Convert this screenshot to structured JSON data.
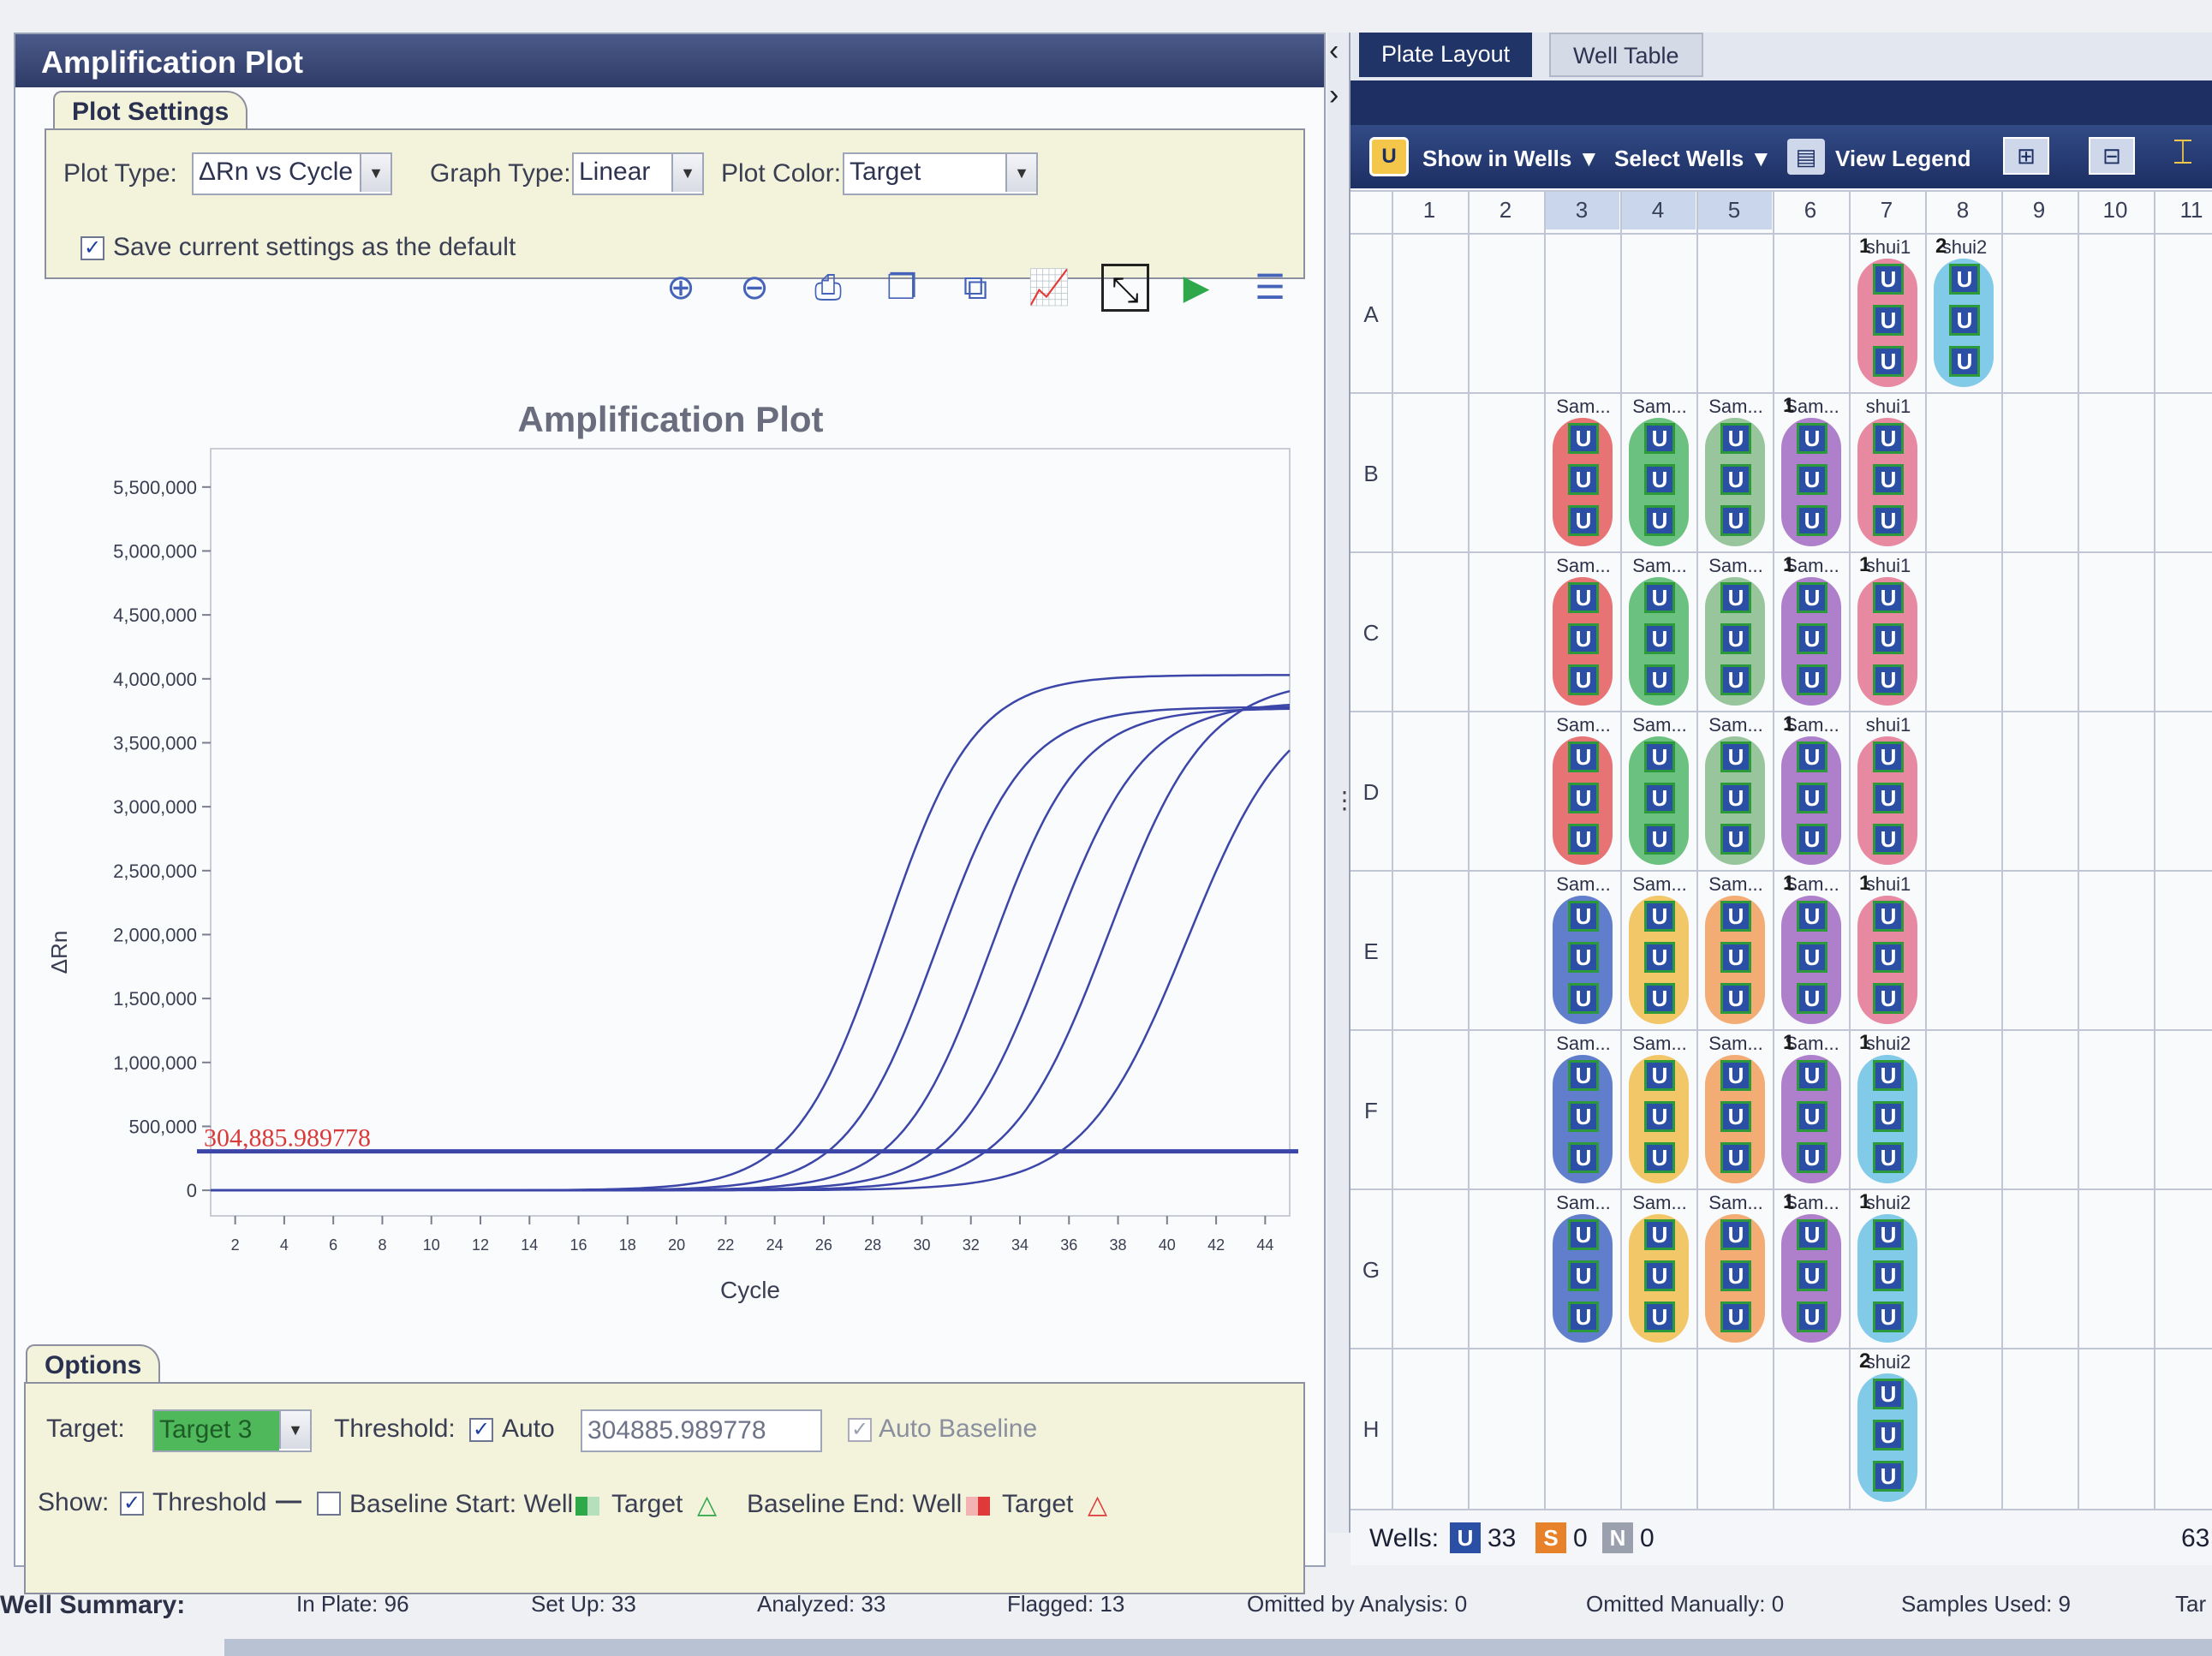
{
  "left_panel": {
    "title": "Amplification Plot",
    "plot_settings": {
      "group_label": "Plot Settings",
      "plot_type_label": "Plot Type:",
      "plot_type_value": "ΔRn vs Cycle",
      "graph_type_label": "Graph Type:",
      "graph_type_value": "Linear",
      "plot_color_label": "Plot Color:",
      "plot_color_value": "Target",
      "save_default_label": "Save current settings as the default",
      "save_default_checked": true
    },
    "toolbar_icons": [
      "zoom-in-icon",
      "zoom-out-icon",
      "print-icon",
      "copy-icon",
      "export-icon",
      "line-chart-icon",
      "expand-icon",
      "play-icon",
      "list-icon"
    ],
    "options": {
      "group_label": "Options",
      "target_label": "Target:",
      "target_value": "Target 3",
      "threshold_label": "Threshold:",
      "auto_label": "Auto",
      "threshold_value": "304885.989778",
      "auto_baseline_label": "Auto Baseline",
      "show_label": "Show:",
      "show_threshold_label": "Threshold",
      "baseline_start_label": "Baseline Start: Well",
      "baseline_start_target": "Target",
      "baseline_end_label": "Baseline End: Well",
      "baseline_end_target": "Target",
      "line_symbol": "—",
      "target_symbol": "△"
    }
  },
  "chart_data": {
    "type": "line",
    "title": "Amplification Plot",
    "xlabel": "Cycle",
    "ylabel": "ΔRn",
    "xlim": [
      1,
      45
    ],
    "ylim": [
      -200000,
      5800000
    ],
    "xticks": [
      "2",
      "4",
      "6",
      "8",
      "10",
      "12",
      "14",
      "16",
      "18",
      "20",
      "22",
      "24",
      "26",
      "28",
      "30",
      "32",
      "34",
      "36",
      "38",
      "40",
      "42",
      "44"
    ],
    "yticks": [
      "5,500,000",
      "5,000,000",
      "4,500,000",
      "4,000,000",
      "3,500,000",
      "3,000,000",
      "2,500,000",
      "2,000,000",
      "1,500,000",
      "1,000,000",
      "500,000",
      "0"
    ],
    "ytick_values": [
      5500000,
      5000000,
      4500000,
      4000000,
      3500000,
      3000000,
      2500000,
      2000000,
      1500000,
      1000000,
      500000,
      0
    ],
    "threshold": 304885.989778,
    "threshold_label": "304,885.989778",
    "series_color": "#3b46a8",
    "threshold_color": "#3b46a8",
    "threshold_label_color": "#d93a3a",
    "curves": [
      {
        "plateau": 4030000,
        "midpoint": 28.5,
        "slope": 0.55
      },
      {
        "plateau": 3780000,
        "midpoint": 30.6,
        "slope": 0.55
      },
      {
        "plateau": 3770000,
        "midpoint": 32.8,
        "slope": 0.55
      },
      {
        "plateau": 3820000,
        "midpoint": 35.2,
        "slope": 0.52
      },
      {
        "plateau": 4000000,
        "midpoint": 37.6,
        "slope": 0.5
      },
      {
        "plateau": 3900000,
        "midpoint": 40.8,
        "slope": 0.48
      }
    ]
  },
  "right_panel": {
    "tabs": [
      {
        "label": "Plate Layout",
        "active": true
      },
      {
        "label": "Well Table",
        "active": false
      }
    ],
    "toolbar": {
      "show_in_wells": "Show in Wells ▼",
      "select_wells": "Select Wells ▼",
      "view_legend": "View Legend"
    },
    "columns": [
      "1",
      "2",
      "3",
      "4",
      "5",
      "6",
      "7",
      "8",
      "9",
      "10",
      "11"
    ],
    "rows": [
      "A",
      "B",
      "C",
      "D",
      "E",
      "F",
      "G",
      "H"
    ],
    "wells_footer": {
      "label": "Wells:",
      "u_icon": "U",
      "u_count": "33",
      "s_icon": "S",
      "s_count": "0",
      "n_icon": "N",
      "n_count": "0",
      "right_count": "63"
    },
    "wells": [
      {
        "row": 0,
        "col": 6,
        "name": "shui1",
        "flag": "1",
        "color": "#e05a7a"
      },
      {
        "row": 0,
        "col": 7,
        "name": "shui2",
        "flag": "2",
        "color": "#4fb5e0"
      },
      {
        "row": 1,
        "col": 2,
        "name": "Sam...",
        "color": "#e0393a"
      },
      {
        "row": 1,
        "col": 3,
        "name": "Sam...",
        "color": "#2fa84a"
      },
      {
        "row": 1,
        "col": 4,
        "name": "Sam...",
        "color": "#6fae72"
      },
      {
        "row": 1,
        "col": 5,
        "name": "Sam...",
        "flag": "1",
        "color": "#8f4bb8"
      },
      {
        "row": 1,
        "col": 6,
        "name": "shui1",
        "color": "#e05a7a"
      },
      {
        "row": 2,
        "col": 2,
        "name": "Sam...",
        "color": "#e0393a"
      },
      {
        "row": 2,
        "col": 3,
        "name": "Sam...",
        "color": "#2fa84a"
      },
      {
        "row": 2,
        "col": 4,
        "name": "Sam...",
        "color": "#6fae72"
      },
      {
        "row": 2,
        "col": 5,
        "name": "Sam...",
        "flag": "1",
        "color": "#8f4bb8"
      },
      {
        "row": 2,
        "col": 6,
        "name": "shui1",
        "flag": "1",
        "color": "#e05a7a"
      },
      {
        "row": 3,
        "col": 2,
        "name": "Sam...",
        "color": "#e0393a"
      },
      {
        "row": 3,
        "col": 3,
        "name": "Sam...",
        "color": "#2fa84a"
      },
      {
        "row": 3,
        "col": 4,
        "name": "Sam...",
        "color": "#6fae72"
      },
      {
        "row": 3,
        "col": 5,
        "name": "Sam...",
        "flag": "1",
        "color": "#8f4bb8"
      },
      {
        "row": 3,
        "col": 6,
        "name": "shui1",
        "color": "#e05a7a"
      },
      {
        "row": 4,
        "col": 2,
        "name": "Sam...",
        "color": "#1f49b8"
      },
      {
        "row": 4,
        "col": 3,
        "name": "Sam...",
        "color": "#f0b02a"
      },
      {
        "row": 4,
        "col": 4,
        "name": "Sam...",
        "color": "#f08a3a"
      },
      {
        "row": 4,
        "col": 5,
        "name": "Sam...",
        "flag": "1",
        "color": "#8f4bb8"
      },
      {
        "row": 4,
        "col": 6,
        "name": "shui1",
        "flag": "1",
        "color": "#e05a7a"
      },
      {
        "row": 5,
        "col": 2,
        "name": "Sam...",
        "color": "#1f49b8"
      },
      {
        "row": 5,
        "col": 3,
        "name": "Sam...",
        "color": "#f0b02a"
      },
      {
        "row": 5,
        "col": 4,
        "name": "Sam...",
        "color": "#f08a3a"
      },
      {
        "row": 5,
        "col": 5,
        "name": "Sam...",
        "flag": "1",
        "color": "#8f4bb8"
      },
      {
        "row": 5,
        "col": 6,
        "name": "shui2",
        "flag": "1",
        "color": "#4fb5e0"
      },
      {
        "row": 6,
        "col": 2,
        "name": "Sam...",
        "color": "#1f49b8"
      },
      {
        "row": 6,
        "col": 3,
        "name": "Sam...",
        "color": "#f0b02a"
      },
      {
        "row": 6,
        "col": 4,
        "name": "Sam...",
        "color": "#f08a3a"
      },
      {
        "row": 6,
        "col": 5,
        "name": "Sam...",
        "flag": "1",
        "color": "#8f4bb8"
      },
      {
        "row": 6,
        "col": 6,
        "name": "shui2",
        "flag": "1",
        "color": "#4fb5e0"
      },
      {
        "row": 7,
        "col": 6,
        "name": "shui2",
        "flag": "2",
        "color": "#4fb5e0"
      }
    ]
  },
  "well_summary": {
    "label": "Well Summary:",
    "in_plate": "In Plate: 96",
    "set_up": "Set Up: 33",
    "analyzed": "Analyzed: 33",
    "flagged": "Flagged: 13",
    "omitted_analysis": "Omitted by Analysis: 0",
    "omitted_manually": "Omitted Manually: 0",
    "samples_used": "Samples Used: 9",
    "targets_partial": "Tar"
  }
}
